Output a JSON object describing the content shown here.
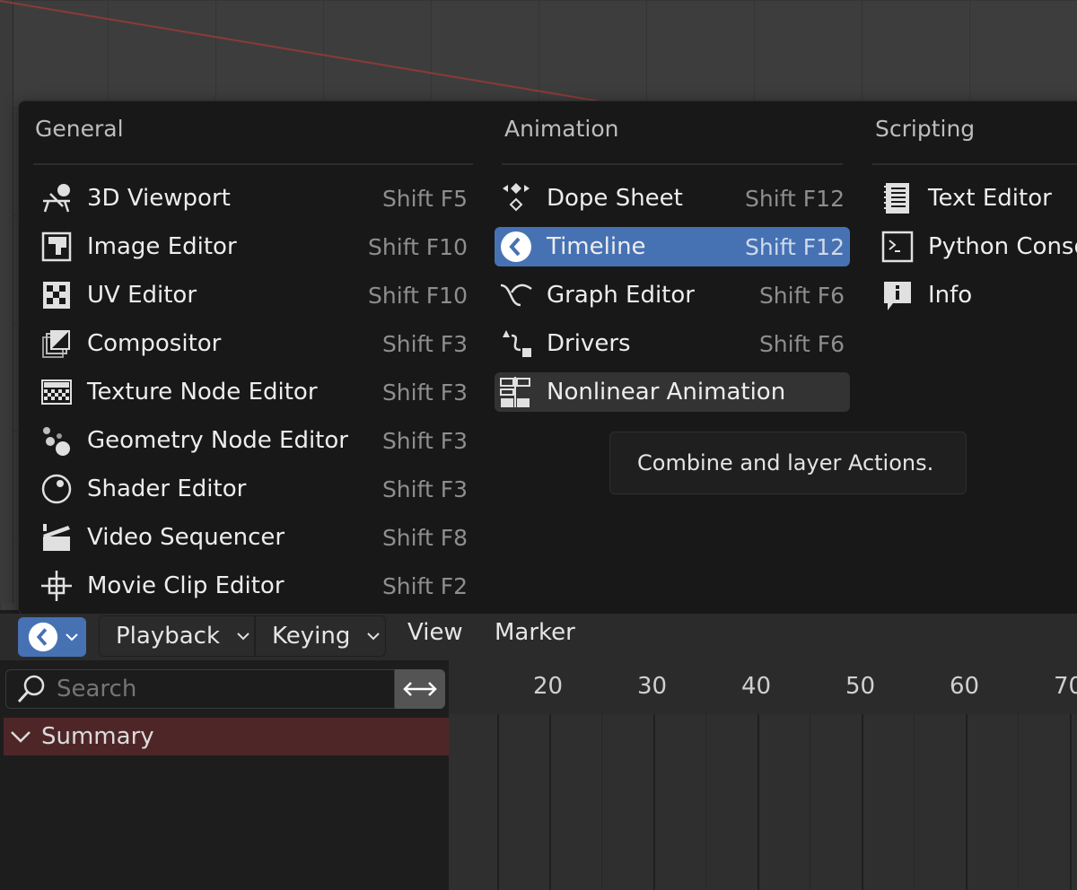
{
  "menu": {
    "columns": [
      {
        "title": "General"
      },
      {
        "title": "Animation"
      },
      {
        "title": "Scripting"
      }
    ],
    "general": [
      {
        "label": "3D Viewport",
        "shortcut": "Shift F5",
        "icon": "viewport-3d-icon"
      },
      {
        "label": "Image Editor",
        "shortcut": "Shift F10",
        "icon": "image-editor-icon"
      },
      {
        "label": "UV Editor",
        "shortcut": "Shift F10",
        "icon": "uv-editor-icon"
      },
      {
        "label": "Compositor",
        "shortcut": "Shift F3",
        "icon": "compositor-icon"
      },
      {
        "label": "Texture Node Editor",
        "shortcut": "Shift F3",
        "icon": "texture-node-icon"
      },
      {
        "label": "Geometry Node Editor",
        "shortcut": "Shift F3",
        "icon": "geometry-node-icon"
      },
      {
        "label": "Shader Editor",
        "shortcut": "Shift F3",
        "icon": "shader-editor-icon"
      },
      {
        "label": "Video Sequencer",
        "shortcut": "Shift F8",
        "icon": "video-sequencer-icon"
      },
      {
        "label": "Movie Clip Editor",
        "shortcut": "Shift F2",
        "icon": "movie-clip-icon"
      }
    ],
    "animation": [
      {
        "label": "Dope Sheet",
        "shortcut": "Shift F12",
        "icon": "dope-sheet-icon"
      },
      {
        "label": "Timeline",
        "shortcut": "Shift F12",
        "icon": "timeline-icon"
      },
      {
        "label": "Graph Editor",
        "shortcut": "Shift F6",
        "icon": "graph-editor-icon"
      },
      {
        "label": "Drivers",
        "shortcut": "Shift F6",
        "icon": "drivers-icon"
      },
      {
        "label": "Nonlinear Animation",
        "shortcut": "",
        "icon": "nla-icon"
      }
    ],
    "scripting": [
      {
        "label": "Text Editor",
        "icon": "text-editor-icon"
      },
      {
        "label": "Python Conso",
        "icon": "python-console-icon"
      },
      {
        "label": "Info",
        "icon": "info-icon"
      }
    ],
    "tooltip": "Combine and layer Actions."
  },
  "header": {
    "playback": "Playback",
    "keying": "Keying",
    "view": "View",
    "marker": "Marker"
  },
  "channels": {
    "search_placeholder": "Search",
    "summary": "Summary"
  },
  "timeline": {
    "ticks": [
      "20",
      "30",
      "40",
      "50",
      "60",
      "70"
    ]
  },
  "colors": {
    "accent": "#4672b4",
    "summary_bg": "#4f2628"
  }
}
